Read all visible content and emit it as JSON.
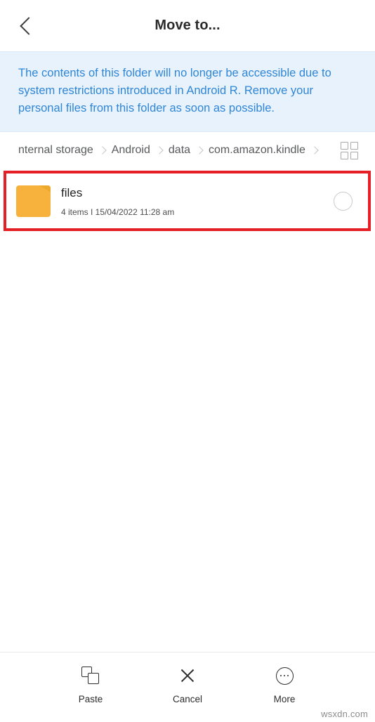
{
  "header": {
    "title": "Move to...",
    "back_icon": "chevron-left-icon"
  },
  "notice": {
    "message": "The contents of this folder will no longer be accessible due to system restrictions introduced in Android R. Remove your personal files from this folder as soon as possible.",
    "background_color": "#e8f2fd",
    "text_color": "#2f86d6"
  },
  "breadcrumb": {
    "segments": [
      {
        "label": "nternal storage"
      },
      {
        "label": "Android"
      },
      {
        "label": "data"
      },
      {
        "label": "com.amazon.kindle"
      }
    ],
    "separator": "chevron-right-icon",
    "view_toggle_icon": "grid-view-icon"
  },
  "file_list": {
    "items": [
      {
        "icon": "folder-icon",
        "name": "files",
        "subtitle": "4 items  I  15/04/2022 11:28 am",
        "selected": false,
        "highlighted": true
      }
    ],
    "highlight_color": "#e61e25",
    "folder_color": "#f7b23e"
  },
  "bottom_toolbar": {
    "actions": [
      {
        "label": "Paste",
        "icon": "paste-icon"
      },
      {
        "label": "Cancel",
        "icon": "close-x-icon"
      },
      {
        "label": "More",
        "icon": "more-dots-icon"
      }
    ]
  },
  "watermark": {
    "text": "wsxdn.com"
  }
}
